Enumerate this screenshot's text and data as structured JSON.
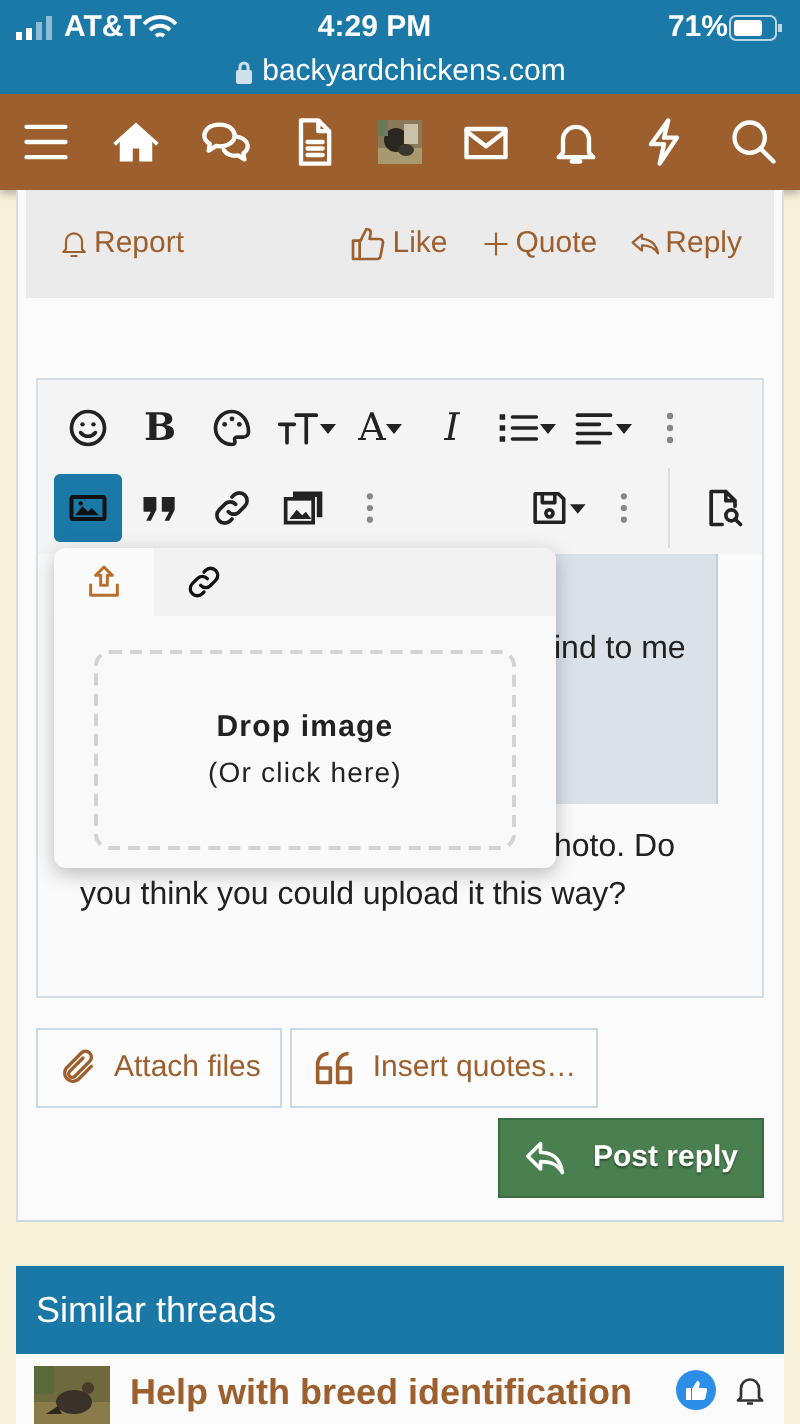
{
  "status_bar": {
    "carrier": "AT&T",
    "time": "4:29 PM",
    "battery": "71%",
    "url": "backyardchickens.com"
  },
  "post_actions": [
    {
      "label": "Report"
    },
    {
      "label": "Like"
    },
    {
      "label": "Quote"
    },
    {
      "label": "Reply"
    }
  ],
  "toolbar": {
    "row1": [
      {
        "kind": "icon",
        "caret": false,
        "active": false
      },
      {
        "kind": "text",
        "label": "B",
        "caret": false,
        "active": false
      },
      {
        "kind": "icon",
        "caret": false,
        "active": false
      },
      {
        "kind": "icon",
        "caret": true,
        "active": false
      },
      {
        "kind": "text",
        "label": "A",
        "caret": true,
        "active": false
      },
      {
        "kind": "text",
        "label": "I",
        "caret": false,
        "active": false
      },
      {
        "kind": "icon",
        "caret": true,
        "active": false
      },
      {
        "kind": "icon",
        "caret": true,
        "active": false
      },
      {
        "kind": "more"
      }
    ],
    "row2": [
      {
        "kind": "icon",
        "caret": false,
        "active": true
      },
      {
        "kind": "icon",
        "caret": false,
        "active": false
      },
      {
        "kind": "icon",
        "caret": false,
        "active": false
      },
      {
        "kind": "icon",
        "caret": false,
        "active": false
      },
      {
        "kind": "more"
      },
      {
        "kind": "spacer"
      },
      {
        "kind": "icon",
        "caret": true,
        "active": false
      },
      {
        "kind": "more"
      },
      {
        "kind": "icon",
        "caret": false,
        "active": false
      }
    ]
  },
  "editor": {
    "quote_text": "ind to me",
    "lines": [
      "hoto. Do",
      "you think you could upload it this way?"
    ]
  },
  "image_popup": {
    "tabs": [
      {
        "selected": true
      },
      {
        "selected": false
      }
    ],
    "drop_title": "Drop image",
    "drop_hint": "(Or click here)"
  },
  "buttons": {
    "attach": "Attach files",
    "insert": "Insert quotes…",
    "post": "Post reply"
  },
  "similar": {
    "title": "Similar threads",
    "threads": [
      {
        "title": "Help with breed identification"
      }
    ]
  }
}
